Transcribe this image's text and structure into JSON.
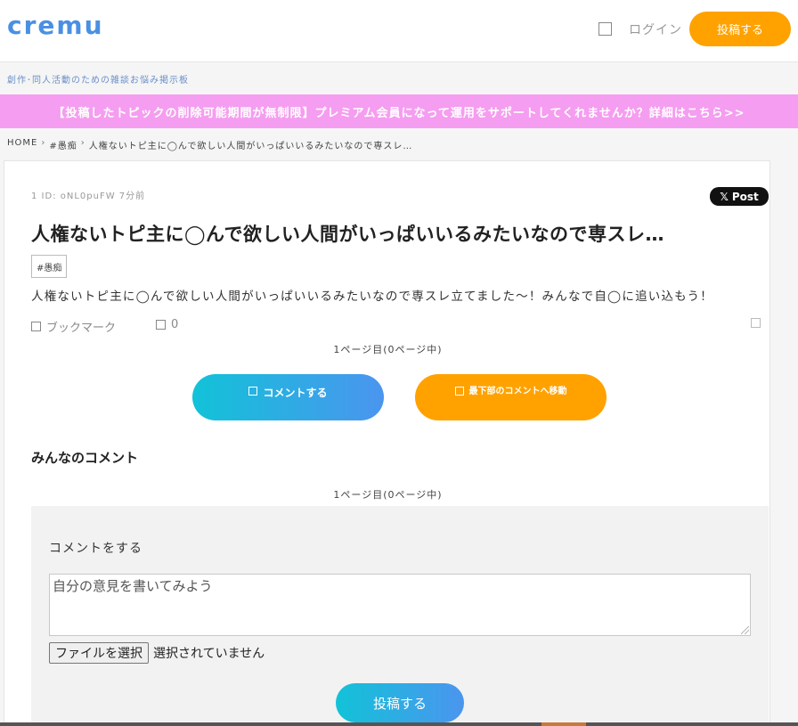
{
  "header": {
    "logo": "cremu",
    "icon": "square-icon",
    "login_label": "ログイン",
    "post_label": "投稿する"
  },
  "tagline": "創作･同人活動のための雑談お悩み掲示板",
  "banner": "【投稿したトピックの削除可能期間が無制限】プレミアム会員になって運用をサポートしてくれませんか？詳細はこちら>>",
  "breadcrumb": [
    "HOME",
    "#愚痴",
    "人権ないトピ主に◯んで欲しい人間がいっぱいいるみたいなので専スレ…"
  ],
  "post": {
    "meta": "1 ID: oNL0puFW 7分前",
    "x_post_label": "Post",
    "title": "人権ないトピ主に◯んで欲しい人間がいっぱいいるみたいなので専スレ…",
    "tag": "#愚痴",
    "body": "人権ないトピ主に◯んで欲しい人間がいっぱいいるみたいなので専スレ立てました～！みんなで自◯に追い込もう！",
    "bookmark_label": "ブックマーク",
    "count": "0",
    "page_info": "1ページ目(0ページ中)",
    "comment_btn": "コメントする",
    "bottom_btn": "最下部のコメントへ移動"
  },
  "comments": {
    "section_title": "みんなのコメント",
    "page_info": "1ページ目(0ページ中)",
    "form_label": "コメントをする",
    "textarea_placeholder": "自分の意見を書いてみよう",
    "file_button": "ファイルを選択",
    "file_status": "選択されていません",
    "submit_label": "投稿する"
  },
  "colors": {
    "brand": "#4a90e2",
    "accent_orange": "#ffa200",
    "banner_pink": "#f59df0"
  }
}
